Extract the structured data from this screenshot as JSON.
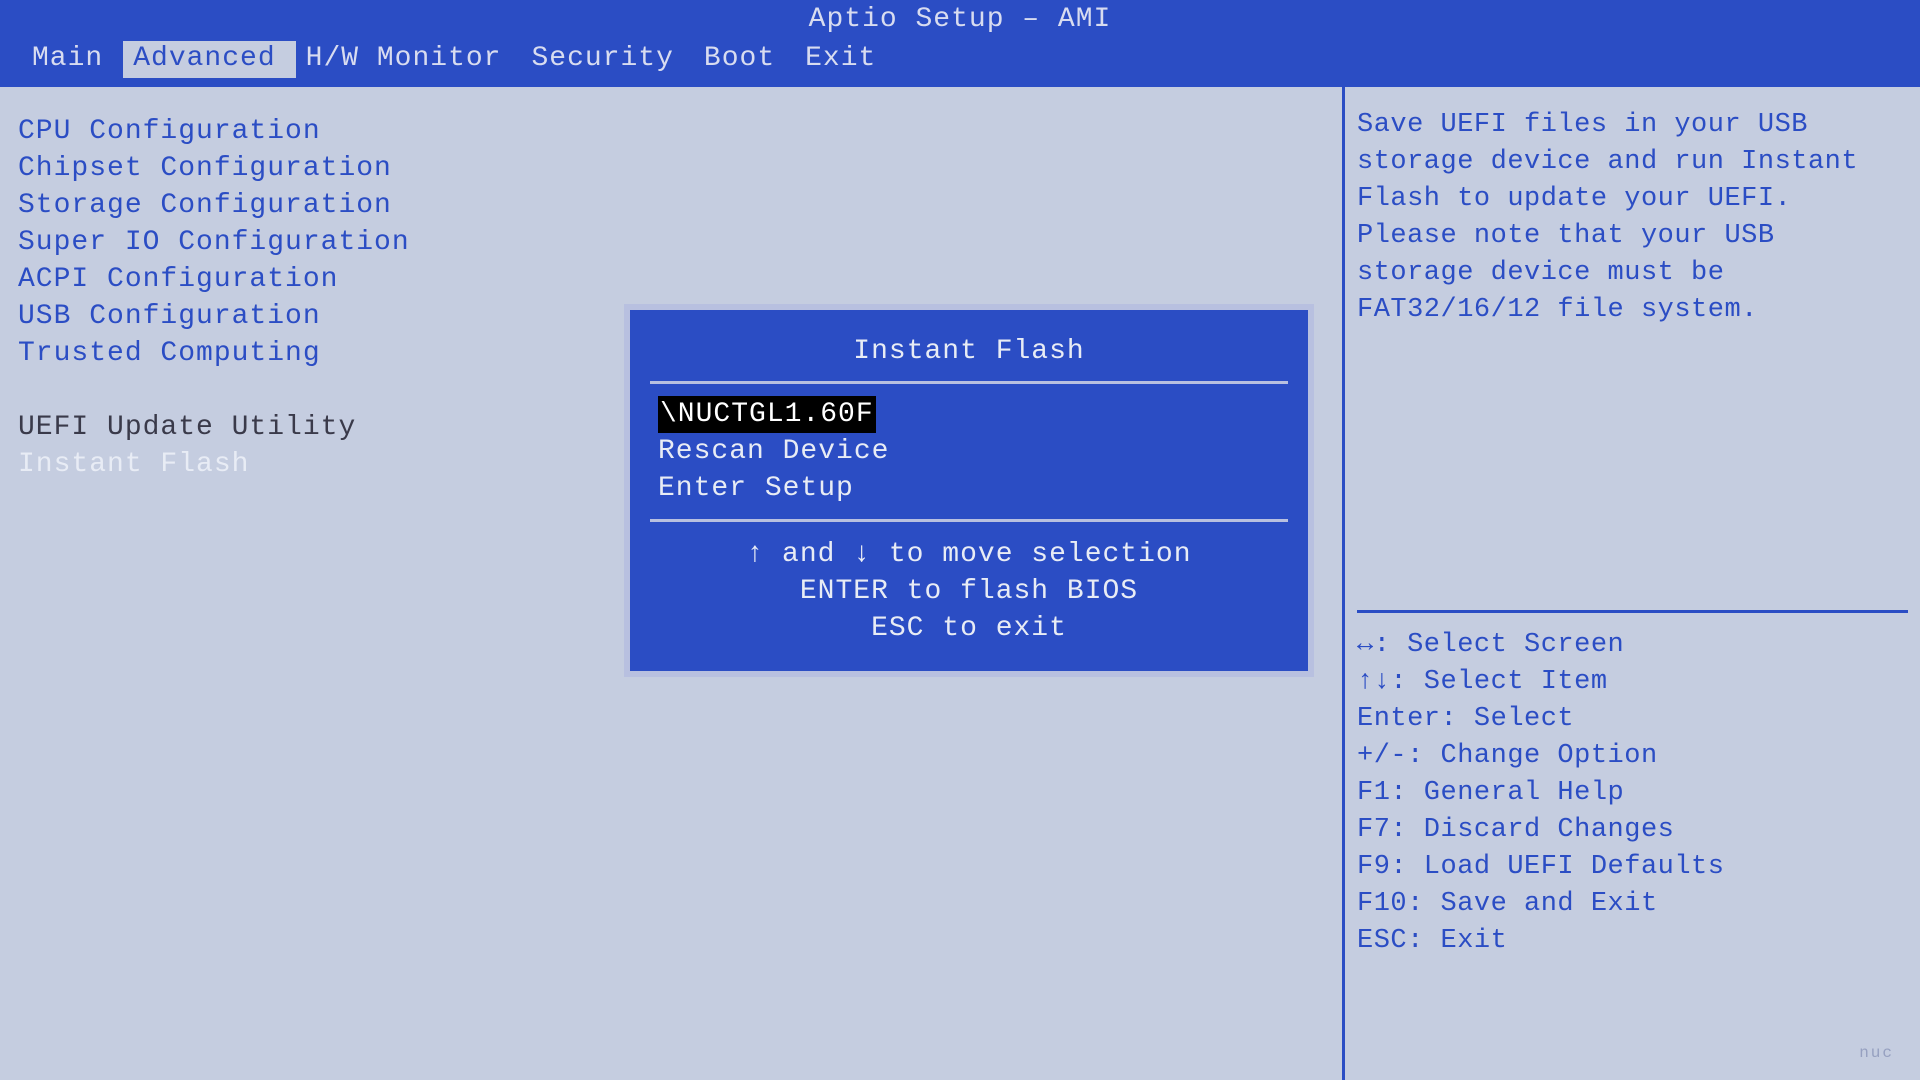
{
  "header": {
    "title": "Aptio Setup – AMI"
  },
  "tabs": [
    {
      "label": "Main"
    },
    {
      "label": "Advanced"
    },
    {
      "label": "H/W Monitor"
    },
    {
      "label": "Security"
    },
    {
      "label": "Boot"
    },
    {
      "label": "Exit"
    }
  ],
  "menu": {
    "items": [
      "CPU Configuration",
      "Chipset Configuration",
      "Storage Configuration",
      "Super IO Configuration",
      "ACPI Configuration",
      "USB Configuration",
      "Trusted Computing"
    ],
    "section_header": "UEFI Update Utility",
    "selected_item": "Instant Flash"
  },
  "help": {
    "text": "Save UEFI files in your USB storage device and run Instant Flash to update your UEFI. Please note that your USB storage device must be FAT32/16/12 file system."
  },
  "hints": [
    "↔: Select Screen",
    "↑↓: Select Item",
    "Enter: Select",
    "+/-: Change Option",
    "F1: General Help",
    "F7: Discard Changes",
    "F9: Load UEFI Defaults",
    "F10: Save and Exit",
    "ESC: Exit"
  ],
  "dialog": {
    "title": "Instant Flash",
    "items": [
      "\\NUCTGL1.60F",
      "Rescan Device",
      "Enter Setup"
    ],
    "footer_lines": [
      "↑ and ↓ to move selection",
      "ENTER to flash BIOS",
      "ESC to exit"
    ]
  },
  "watermark": "nuc"
}
